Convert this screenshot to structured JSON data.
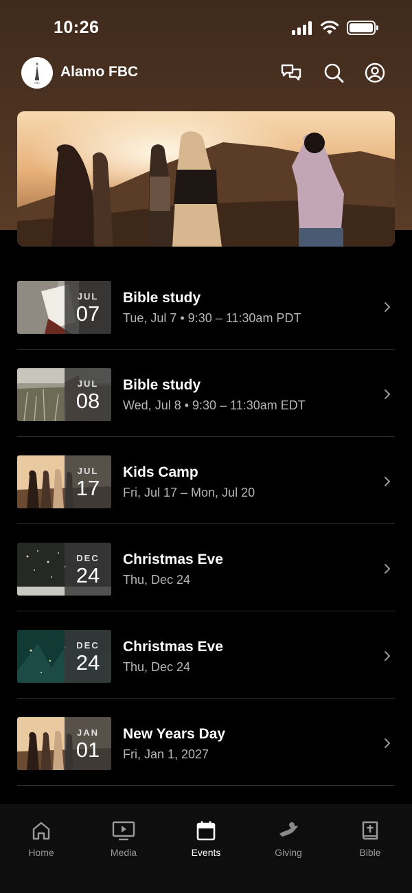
{
  "status_bar": {
    "time": "10:26"
  },
  "header": {
    "church_name": "Alamo FBC",
    "logo_text": "FBC"
  },
  "events": [
    {
      "month": "JUL",
      "day": "07",
      "title": "Bible study",
      "subtitle": "Tue, Jul 7 • 9:30 – 11:30am PDT",
      "thumb": "book"
    },
    {
      "month": "JUL",
      "day": "08",
      "title": "Bible study",
      "subtitle": "Wed, Jul 8 • 9:30 – 11:30am EDT",
      "thumb": "field"
    },
    {
      "month": "JUL",
      "day": "17",
      "title": "Kids Camp",
      "subtitle": "Fri, Jul 17 – Mon, Jul 20",
      "thumb": "sunset"
    },
    {
      "month": "DEC",
      "day": "24",
      "title": "Christmas Eve",
      "subtitle": "Thu, Dec 24",
      "thumb": "lights"
    },
    {
      "month": "DEC",
      "day": "24",
      "title": "Christmas Eve",
      "subtitle": "Thu, Dec 24",
      "thumb": "tree"
    },
    {
      "month": "JAN",
      "day": "01",
      "title": "New Years Day",
      "subtitle": "Fri, Jan 1, 2027",
      "thumb": "sunset"
    }
  ],
  "tabs": [
    {
      "label": "Home",
      "icon": "home-icon",
      "active": false
    },
    {
      "label": "Media",
      "icon": "media-icon",
      "active": false
    },
    {
      "label": "Events",
      "icon": "calendar-icon",
      "active": true
    },
    {
      "label": "Giving",
      "icon": "giving-icon",
      "active": false
    },
    {
      "label": "Bible",
      "icon": "bible-icon",
      "active": false
    }
  ],
  "colors": {
    "header_bg": "#4d3322",
    "background": "#000000",
    "tabbar_bg": "#0e0e0e",
    "muted_text": "#b5b5b5"
  }
}
